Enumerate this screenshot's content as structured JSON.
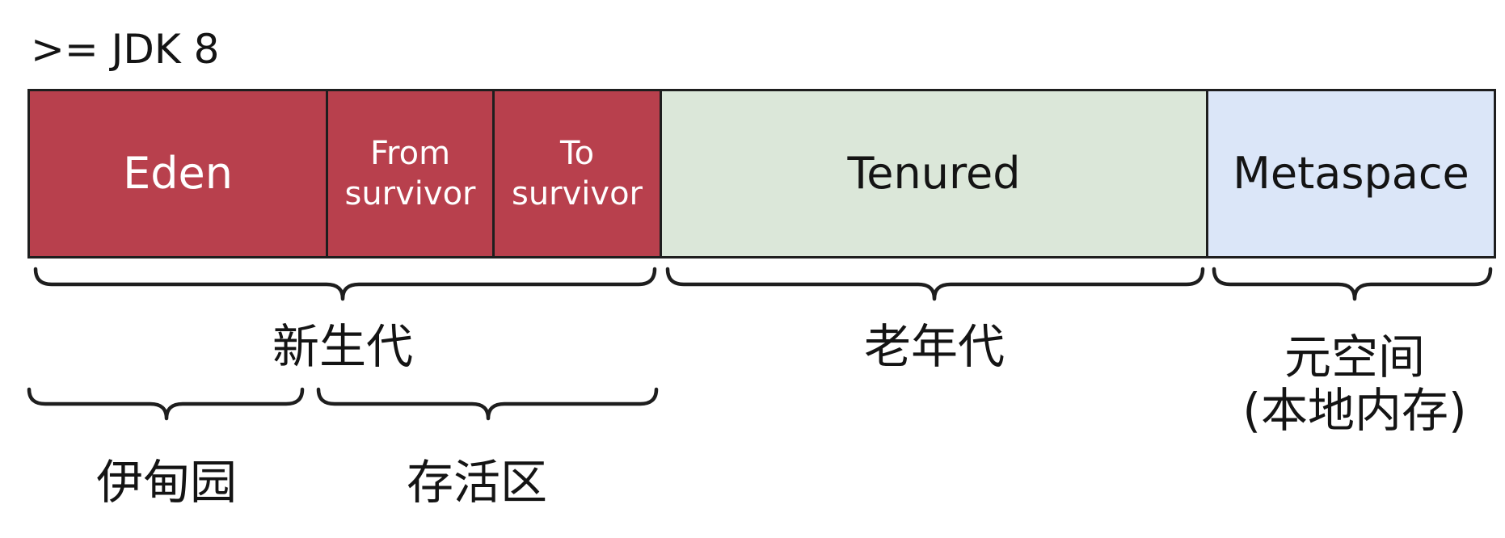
{
  "title": ">= JDK 8",
  "blocks": {
    "eden": "Eden",
    "from_survivor": [
      "From",
      "survivor"
    ],
    "to_survivor": [
      "To",
      "survivor"
    ],
    "tenured": "Tenured",
    "metaspace": "Metaspace"
  },
  "labels": {
    "young_generation": "新生代",
    "old_generation": "老年代",
    "metaspace": [
      "元空间",
      "(本地内存)"
    ],
    "eden": "伊甸园",
    "survivor": "存活区"
  },
  "colors": {
    "young": "#b8404d",
    "tenured": "#dbe7d9",
    "metaspace": "#dbe6f8",
    "border": "#1e1e1e"
  }
}
